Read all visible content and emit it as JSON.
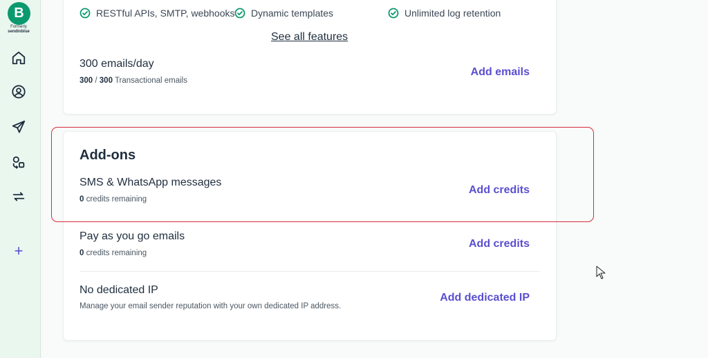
{
  "sidebar": {
    "logo_letter": "B",
    "logo_formerly": "Formerly",
    "logo_brand": "sendinblue",
    "items": [
      {
        "icon": "home-icon"
      },
      {
        "icon": "contacts-icon"
      },
      {
        "icon": "campaigns-send-icon"
      },
      {
        "icon": "automation-icon"
      },
      {
        "icon": "transactional-icon"
      }
    ],
    "add_label": "+"
  },
  "features": [
    {
      "label": "RESTful APIs, SMTP, webhooks"
    },
    {
      "label": "Dynamic templates"
    },
    {
      "label": "Unlimited log retention"
    }
  ],
  "see_all_label": "See all features",
  "plan_row": {
    "title": "300 emails/day",
    "used": "300",
    "separator": " / ",
    "total": "300",
    "suffix": " Transactional emails",
    "action": "Add emails"
  },
  "addons": {
    "title": "Add-ons",
    "rows": [
      {
        "title": "SMS & WhatsApp messages",
        "count": "0",
        "sub": " credits remaining",
        "action": "Add credits"
      },
      {
        "title": "Pay as you go emails",
        "count": "0",
        "sub": " credits remaining",
        "action": "Add credits"
      },
      {
        "title": "No dedicated IP",
        "sub": "Manage your email sender reputation with your own dedicated IP address.",
        "action": "Add dedicated IP"
      }
    ]
  },
  "colors": {
    "brand_green": "#0b996e",
    "link_purple": "#5a4fcf",
    "highlight_red": "#d62b3a"
  }
}
